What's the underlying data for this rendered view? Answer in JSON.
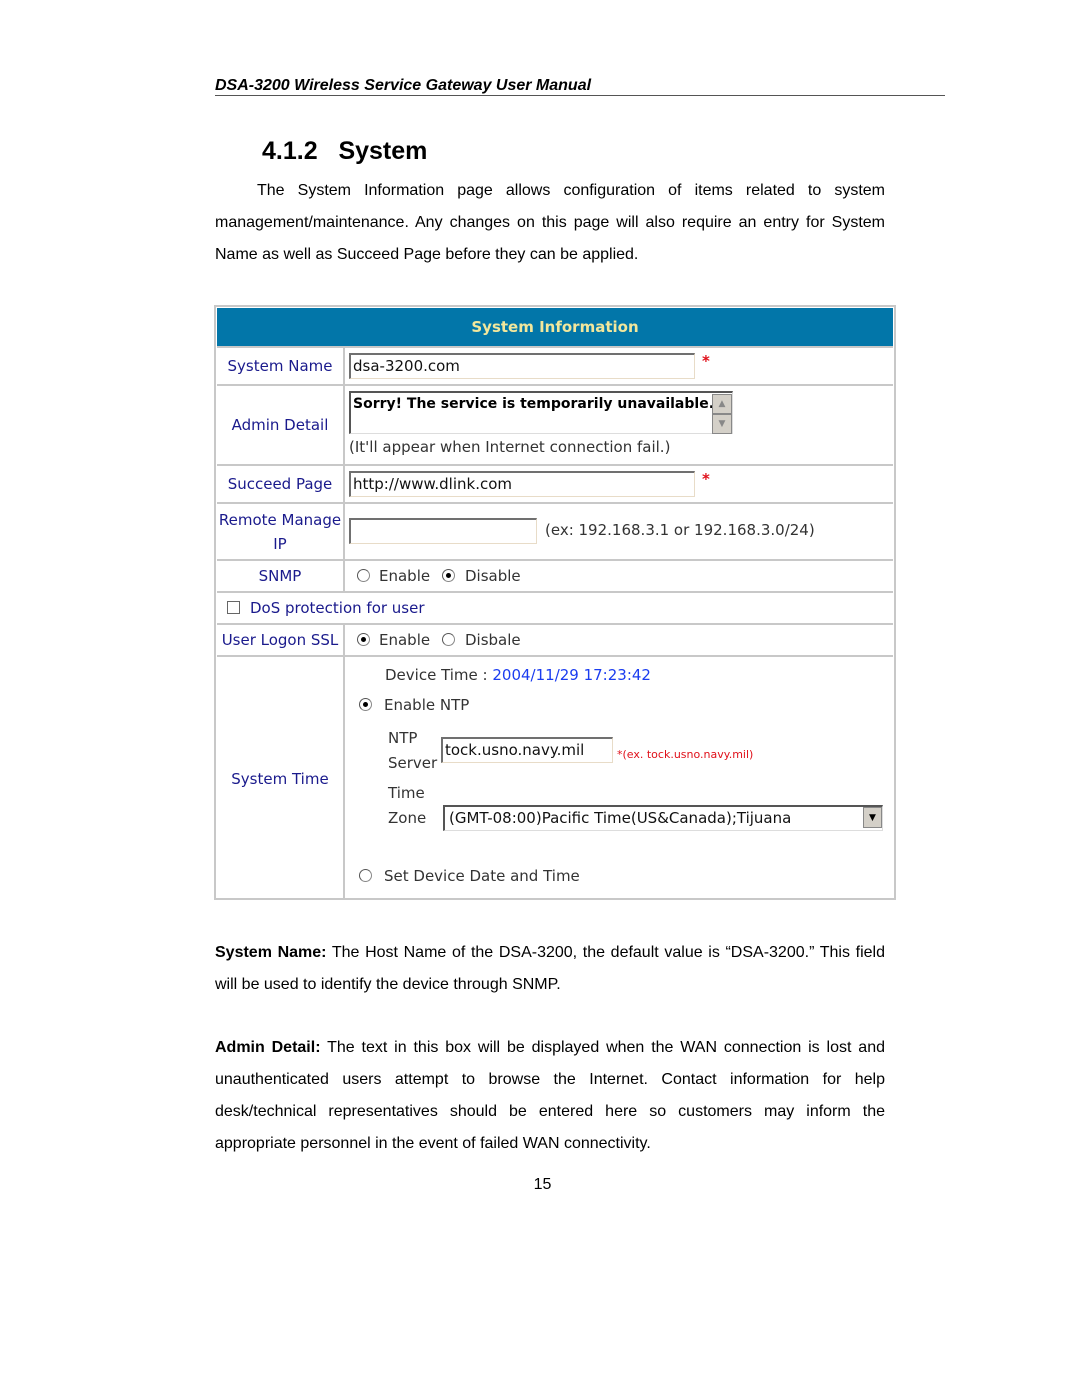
{
  "doc": {
    "running_header": "DSA-3200 Wireless Service Gateway User Manual",
    "section_number": "4.1.2",
    "section_title": "System",
    "intro": "The System Information page allows configuration of items related to system management/maintenance. Any changes on this page will also require an entry for System Name as well as Succeed Page before they can be applied.",
    "desc_system_name": {
      "term": "System Name:",
      "text": " The Host Name of the DSA-3200, the default value is “DSA-3200.” This field will be used to identify the device through SNMP."
    },
    "desc_admin_detail": {
      "term": "Admin Detail:",
      "text": " The text in this box will be displayed when the WAN connection is lost and unauthenticated users attempt to browse the Internet. Contact information for help desk/technical representatives should be entered here so customers may inform the appropriate personnel in the event of failed WAN connectivity."
    },
    "page_number": "15"
  },
  "panel": {
    "title": "System Information",
    "colors": {
      "header_bg": "#0276a9",
      "header_text": "#f2e79c",
      "label_text": "#1a1a8c",
      "required": "#e0101a",
      "device_time": "#1a3cf0"
    },
    "system_name": {
      "label": "System Name",
      "value": "dsa-3200.com",
      "required_mark": "*"
    },
    "admin_detail": {
      "label": "Admin Detail",
      "value": "Sorry! The service is temporarily unavailable.",
      "note": "(It'll appear when Internet connection fail.)",
      "scroll_up_icon": "▲",
      "scroll_down_icon": "▼"
    },
    "succeed_page": {
      "label": "Succeed Page",
      "value": "http://www.dlink.com",
      "required_mark": "*"
    },
    "remote_manage_ip": {
      "label_line1": "Remote Manage",
      "label_line2": "IP",
      "value": "",
      "hint": "(ex: 192.168.3.1 or 192.168.3.0/24)"
    },
    "snmp": {
      "label": "SNMP",
      "options": [
        {
          "label": "Enable",
          "selected": false
        },
        {
          "label": "Disable",
          "selected": true
        }
      ]
    },
    "dos_protection": {
      "label": "DoS protection for user",
      "checked": false
    },
    "user_logon_ssl": {
      "label": "User Logon SSL",
      "options": [
        {
          "label": "Enable",
          "selected": true
        },
        {
          "label": "Disbale",
          "selected": false
        }
      ]
    },
    "system_time": {
      "label": "System Time",
      "device_time_label": "Device Time : ",
      "device_time_value": "2004/11/29 17:23:42",
      "enable_ntp_label": "Enable NTP",
      "enable_ntp_selected": true,
      "ntp_server_label_1": "NTP",
      "ntp_server_label_2": "Server",
      "ntp_server_value": "tock.usno.navy.mil",
      "ntp_server_hint": "*(ex. tock.usno.navy.mil)",
      "time_zone_label_1": "Time",
      "time_zone_label_2": "Zone",
      "time_zone_value": "(GMT-08:00)Pacific Time(US&Canada);Tijuana",
      "dropdown_icon": "▼",
      "set_device_label": "Set Device Date and Time",
      "set_device_selected": false
    }
  }
}
